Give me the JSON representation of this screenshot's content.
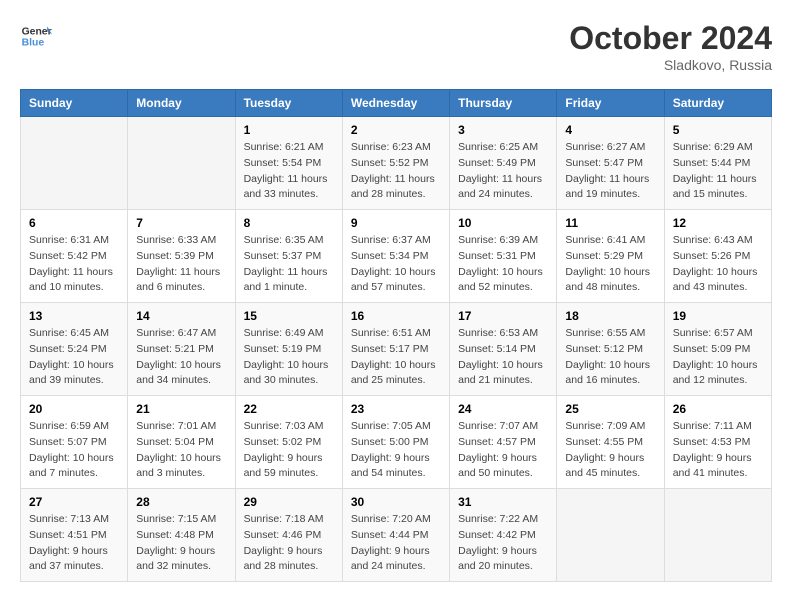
{
  "logo": {
    "line1": "General",
    "line2": "Blue"
  },
  "title": "October 2024",
  "subtitle": "Sladkovo, Russia",
  "days_header": [
    "Sunday",
    "Monday",
    "Tuesday",
    "Wednesday",
    "Thursday",
    "Friday",
    "Saturday"
  ],
  "weeks": [
    [
      {
        "day": "",
        "info": ""
      },
      {
        "day": "",
        "info": ""
      },
      {
        "day": "1",
        "info": "Sunrise: 6:21 AM\nSunset: 5:54 PM\nDaylight: 11 hours\nand 33 minutes."
      },
      {
        "day": "2",
        "info": "Sunrise: 6:23 AM\nSunset: 5:52 PM\nDaylight: 11 hours\nand 28 minutes."
      },
      {
        "day": "3",
        "info": "Sunrise: 6:25 AM\nSunset: 5:49 PM\nDaylight: 11 hours\nand 24 minutes."
      },
      {
        "day": "4",
        "info": "Sunrise: 6:27 AM\nSunset: 5:47 PM\nDaylight: 11 hours\nand 19 minutes."
      },
      {
        "day": "5",
        "info": "Sunrise: 6:29 AM\nSunset: 5:44 PM\nDaylight: 11 hours\nand 15 minutes."
      }
    ],
    [
      {
        "day": "6",
        "info": "Sunrise: 6:31 AM\nSunset: 5:42 PM\nDaylight: 11 hours\nand 10 minutes."
      },
      {
        "day": "7",
        "info": "Sunrise: 6:33 AM\nSunset: 5:39 PM\nDaylight: 11 hours\nand 6 minutes."
      },
      {
        "day": "8",
        "info": "Sunrise: 6:35 AM\nSunset: 5:37 PM\nDaylight: 11 hours\nand 1 minute."
      },
      {
        "day": "9",
        "info": "Sunrise: 6:37 AM\nSunset: 5:34 PM\nDaylight: 10 hours\nand 57 minutes."
      },
      {
        "day": "10",
        "info": "Sunrise: 6:39 AM\nSunset: 5:31 PM\nDaylight: 10 hours\nand 52 minutes."
      },
      {
        "day": "11",
        "info": "Sunrise: 6:41 AM\nSunset: 5:29 PM\nDaylight: 10 hours\nand 48 minutes."
      },
      {
        "day": "12",
        "info": "Sunrise: 6:43 AM\nSunset: 5:26 PM\nDaylight: 10 hours\nand 43 minutes."
      }
    ],
    [
      {
        "day": "13",
        "info": "Sunrise: 6:45 AM\nSunset: 5:24 PM\nDaylight: 10 hours\nand 39 minutes."
      },
      {
        "day": "14",
        "info": "Sunrise: 6:47 AM\nSunset: 5:21 PM\nDaylight: 10 hours\nand 34 minutes."
      },
      {
        "day": "15",
        "info": "Sunrise: 6:49 AM\nSunset: 5:19 PM\nDaylight: 10 hours\nand 30 minutes."
      },
      {
        "day": "16",
        "info": "Sunrise: 6:51 AM\nSunset: 5:17 PM\nDaylight: 10 hours\nand 25 minutes."
      },
      {
        "day": "17",
        "info": "Sunrise: 6:53 AM\nSunset: 5:14 PM\nDaylight: 10 hours\nand 21 minutes."
      },
      {
        "day": "18",
        "info": "Sunrise: 6:55 AM\nSunset: 5:12 PM\nDaylight: 10 hours\nand 16 minutes."
      },
      {
        "day": "19",
        "info": "Sunrise: 6:57 AM\nSunset: 5:09 PM\nDaylight: 10 hours\nand 12 minutes."
      }
    ],
    [
      {
        "day": "20",
        "info": "Sunrise: 6:59 AM\nSunset: 5:07 PM\nDaylight: 10 hours\nand 7 minutes."
      },
      {
        "day": "21",
        "info": "Sunrise: 7:01 AM\nSunset: 5:04 PM\nDaylight: 10 hours\nand 3 minutes."
      },
      {
        "day": "22",
        "info": "Sunrise: 7:03 AM\nSunset: 5:02 PM\nDaylight: 9 hours\nand 59 minutes."
      },
      {
        "day": "23",
        "info": "Sunrise: 7:05 AM\nSunset: 5:00 PM\nDaylight: 9 hours\nand 54 minutes."
      },
      {
        "day": "24",
        "info": "Sunrise: 7:07 AM\nSunset: 4:57 PM\nDaylight: 9 hours\nand 50 minutes."
      },
      {
        "day": "25",
        "info": "Sunrise: 7:09 AM\nSunset: 4:55 PM\nDaylight: 9 hours\nand 45 minutes."
      },
      {
        "day": "26",
        "info": "Sunrise: 7:11 AM\nSunset: 4:53 PM\nDaylight: 9 hours\nand 41 minutes."
      }
    ],
    [
      {
        "day": "27",
        "info": "Sunrise: 7:13 AM\nSunset: 4:51 PM\nDaylight: 9 hours\nand 37 minutes."
      },
      {
        "day": "28",
        "info": "Sunrise: 7:15 AM\nSunset: 4:48 PM\nDaylight: 9 hours\nand 32 minutes."
      },
      {
        "day": "29",
        "info": "Sunrise: 7:18 AM\nSunset: 4:46 PM\nDaylight: 9 hours\nand 28 minutes."
      },
      {
        "day": "30",
        "info": "Sunrise: 7:20 AM\nSunset: 4:44 PM\nDaylight: 9 hours\nand 24 minutes."
      },
      {
        "day": "31",
        "info": "Sunrise: 7:22 AM\nSunset: 4:42 PM\nDaylight: 9 hours\nand 20 minutes."
      },
      {
        "day": "",
        "info": ""
      },
      {
        "day": "",
        "info": ""
      }
    ]
  ]
}
